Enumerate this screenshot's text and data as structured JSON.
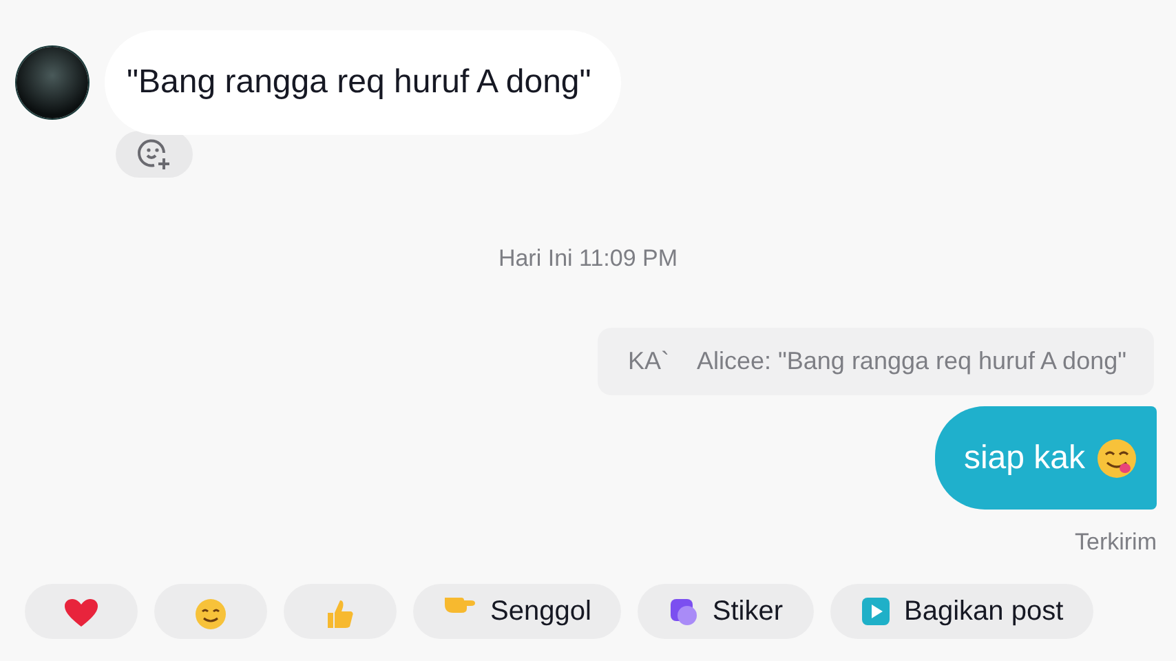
{
  "incoming_message": {
    "text": "\"Bang rangga req huruf A dong\""
  },
  "timestamp": "Hari Ini 11:09 PM",
  "reply_quote": {
    "author": "KA`",
    "text": "Alicee: \"Bang rangga req huruf A dong\""
  },
  "outgoing_message": {
    "text": "siap kak",
    "status": "Terkirim"
  },
  "quick_actions": [
    {
      "kind": "heart"
    },
    {
      "kind": "smile"
    },
    {
      "kind": "thumbs"
    },
    {
      "kind": "poke",
      "label": "Senggol"
    },
    {
      "kind": "sticker",
      "label": "Stiker"
    },
    {
      "kind": "share",
      "label": "Bagikan post"
    }
  ]
}
